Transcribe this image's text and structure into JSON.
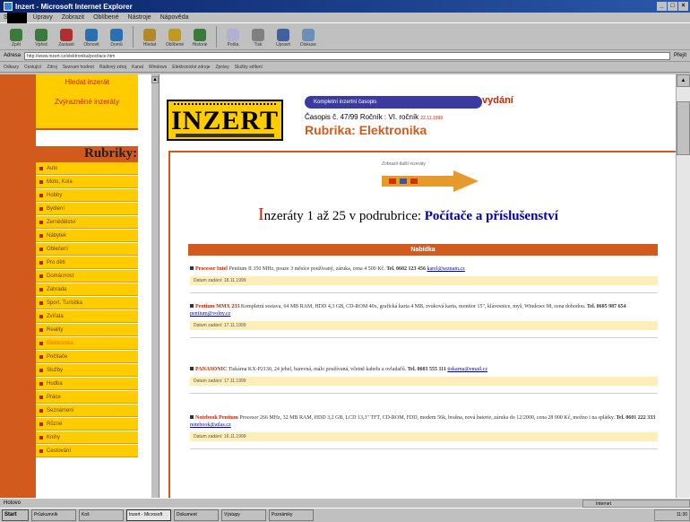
{
  "window": {
    "title": "Inzert - Microsoft Internet Explorer"
  },
  "menu": [
    "Soubor",
    "Úpravy",
    "Zobrazit",
    "Oblíbené",
    "Nástroje",
    "Nápověda"
  ],
  "toolbar": [
    "Zpět",
    "Vpřed",
    "Zastavit",
    "Obnovit",
    "Domů",
    "Hledat",
    "Oblíbené",
    "Historie",
    "Pošta",
    "Tisk",
    "Upravit",
    "Diskuse"
  ],
  "address": {
    "label": "Adresa",
    "value": "http://www.inzert.cz/elektronika/pocitace.htm",
    "go": "Přejít"
  },
  "links": [
    "Odkazy",
    "Cestující",
    "Zdroj",
    "Seznam hodnot",
    "Rádiový zdroj",
    "Kanal",
    "Windows",
    "Elektronické zdroje",
    "Zprávy",
    "Služby sdílení"
  ],
  "sidebar": {
    "top": [
      "Hledat inzerát",
      "Zvýrazněné inzeráty"
    ],
    "title": "Rubriky:",
    "items": [
      "Auto",
      "Moto, Kola",
      "Hobby",
      "Bydlení",
      "Zemědělství",
      "Nábytek",
      "Oblečení",
      "Pro děti",
      "Domácnost",
      "Zahrada",
      "Sport, Turistika",
      "Zvířata",
      "Reality",
      "Elektronika",
      "Počítače",
      "Služby",
      "Hudba",
      "Práce",
      "Seznámení",
      "Různé",
      "Knihy",
      "Cestování"
    ],
    "selected": 13
  },
  "header": {
    "logo": "INZERT",
    "pill": "Kompletní inzertní časopis",
    "vydani": "vydání",
    "issue": "Časopis č. 47/99 Ročník : VI. ročník",
    "issue_date": "22.11.1999",
    "rubrika_label": "Rubrika:",
    "rubrika_value": "Elektronika"
  },
  "main": {
    "next_label": "Zobrazit další inzeráty",
    "title_prefix": "I",
    "title": "nzeráty 1 až 25 v podrubrice: ",
    "title_cat": "Počítače a příslušenství",
    "section": "Nabídka",
    "ads": [
      {
        "head": "Procesor Intel",
        "text": "Pentium II 350 MHz, pouze 3 měsíce používaný, záruka, cena 4 500 Kč.",
        "contact": "Tel. 0602 123 456",
        "email": "karel@seznam.cz",
        "meta": "Datum zadání: 18.11.1999"
      },
      {
        "head": "Pentium MMX 233",
        "text": "Kompletní sestava, 64 MB RAM, HDD 4,3 GB, CD-ROM 40x, grafická karta 4 MB, zvuková karta, monitor 15\", klávesnice, myš, Windows 98, cena dohodou.",
        "contact": "Tel. 0605 987 654",
        "email": "pentium@volny.cz",
        "meta": "Datum zadání: 17.11.1999"
      },
      {
        "head": "PANASONIC",
        "text": "Tiskárna KX-P2130, 24 jehel, barevná, málo používaná, včetně kabelu a ovladačů.",
        "contact": "Tel. 0603 555 111",
        "email": "tiskarna@email.cz",
        "meta": "Datum zadání: 17.11.1999"
      },
      {
        "head": "Notebook Pentium",
        "text": "Procesor 266 MHz, 32 MB RAM, HDD 3,2 GB, LCD 13,3\" TFT, CD-ROM, FDD, modem 56k, brašna, nová baterie, záruka do 12/2000, cena 28 000 Kč, možno i na splátky.",
        "contact": "Tel. 0601 222 333",
        "email": "notebook@atlas.cz",
        "meta": "Datum zadání: 16.11.1999"
      }
    ]
  },
  "status": {
    "text": "Hotovo",
    "zone": "Internet"
  },
  "taskbar": {
    "start": "Start",
    "tasks": [
      "Průzkumník",
      "Koš",
      "Inzert - Microsoft",
      "Dokument",
      "Výstupy",
      "Poznámky"
    ],
    "active": 2,
    "clock": "11:30"
  }
}
